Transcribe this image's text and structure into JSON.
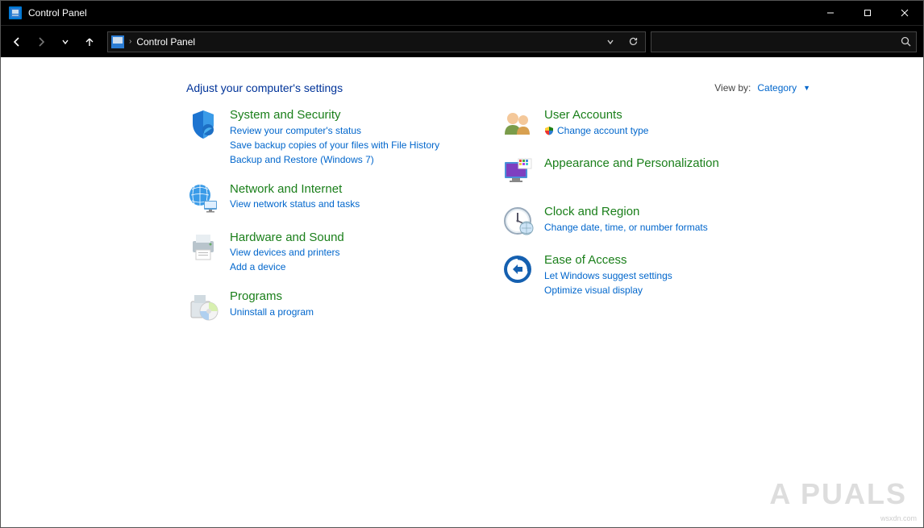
{
  "window": {
    "title": "Control Panel"
  },
  "address": {
    "crumb": "Control Panel"
  },
  "search": {
    "placeholder": ""
  },
  "heading": "Adjust your computer's settings",
  "viewby": {
    "label": "View by:",
    "value": "Category"
  },
  "left": [
    {
      "id": "system-security",
      "title": "System and Security",
      "links": [
        "Review your computer's status",
        "Save backup copies of your files with File History",
        "Backup and Restore (Windows 7)"
      ]
    },
    {
      "id": "network-internet",
      "title": "Network and Internet",
      "links": [
        "View network status and tasks"
      ]
    },
    {
      "id": "hardware-sound",
      "title": "Hardware and Sound",
      "links": [
        "View devices and printers",
        "Add a device"
      ]
    },
    {
      "id": "programs",
      "title": "Programs",
      "links": [
        "Uninstall a program"
      ]
    }
  ],
  "right": [
    {
      "id": "user-accounts",
      "title": "User Accounts",
      "links": [
        "Change account type"
      ],
      "shield": [
        true
      ]
    },
    {
      "id": "appearance",
      "title": "Appearance and Personalization",
      "links": []
    },
    {
      "id": "clock-region",
      "title": "Clock and Region",
      "links": [
        "Change date, time, or number formats"
      ]
    },
    {
      "id": "ease-of-access",
      "title": "Ease of Access",
      "links": [
        "Let Windows suggest settings",
        "Optimize visual display"
      ]
    }
  ],
  "watermark": "A   PUALS",
  "watermark_sub": "wsxdn.com"
}
